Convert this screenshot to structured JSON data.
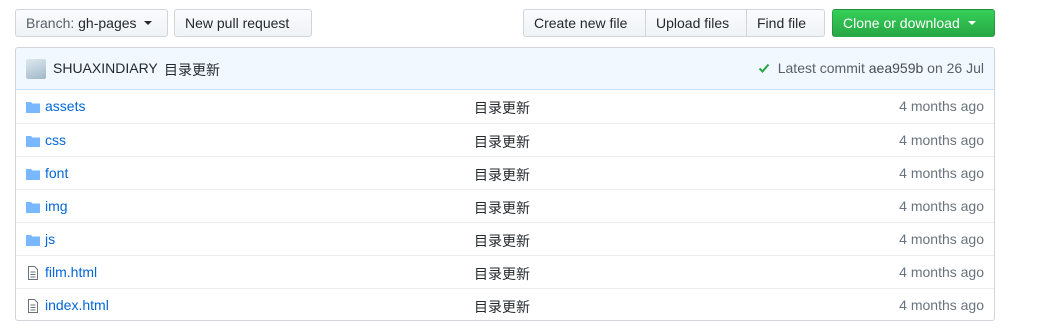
{
  "toolbar": {
    "branch_prefix": "Branch:",
    "branch_name": "gh-pages",
    "new_pull_request": "New pull request",
    "create_new_file": "Create new file",
    "upload_files": "Upload files",
    "find_file": "Find file",
    "clone_or_download": "Clone or download"
  },
  "commit": {
    "author": "SHUAXINDIARY",
    "message": "目录更新",
    "latest_label": "Latest commit",
    "sha": "aea959b",
    "date": "on 26 Jul"
  },
  "files": [
    {
      "name": "assets",
      "type": "folder",
      "message": "目录更新",
      "age": "4 months ago"
    },
    {
      "name": "css",
      "type": "folder",
      "message": "目录更新",
      "age": "4 months ago"
    },
    {
      "name": "font",
      "type": "folder",
      "message": "目录更新",
      "age": "4 months ago"
    },
    {
      "name": "img",
      "type": "folder",
      "message": "目录更新",
      "age": "4 months ago"
    },
    {
      "name": "js",
      "type": "folder",
      "message": "目录更新",
      "age": "4 months ago"
    },
    {
      "name": "film.html",
      "type": "file",
      "message": "目录更新",
      "age": "4 months ago"
    },
    {
      "name": "index.html",
      "type": "file",
      "message": "目录更新",
      "age": "4 months ago"
    }
  ],
  "colors": {
    "link": "#0366d6",
    "folder_icon": "#79b8ff",
    "file_icon": "#6a737d",
    "success": "#28a745",
    "commit_bar_bg": "#f1f8ff"
  }
}
